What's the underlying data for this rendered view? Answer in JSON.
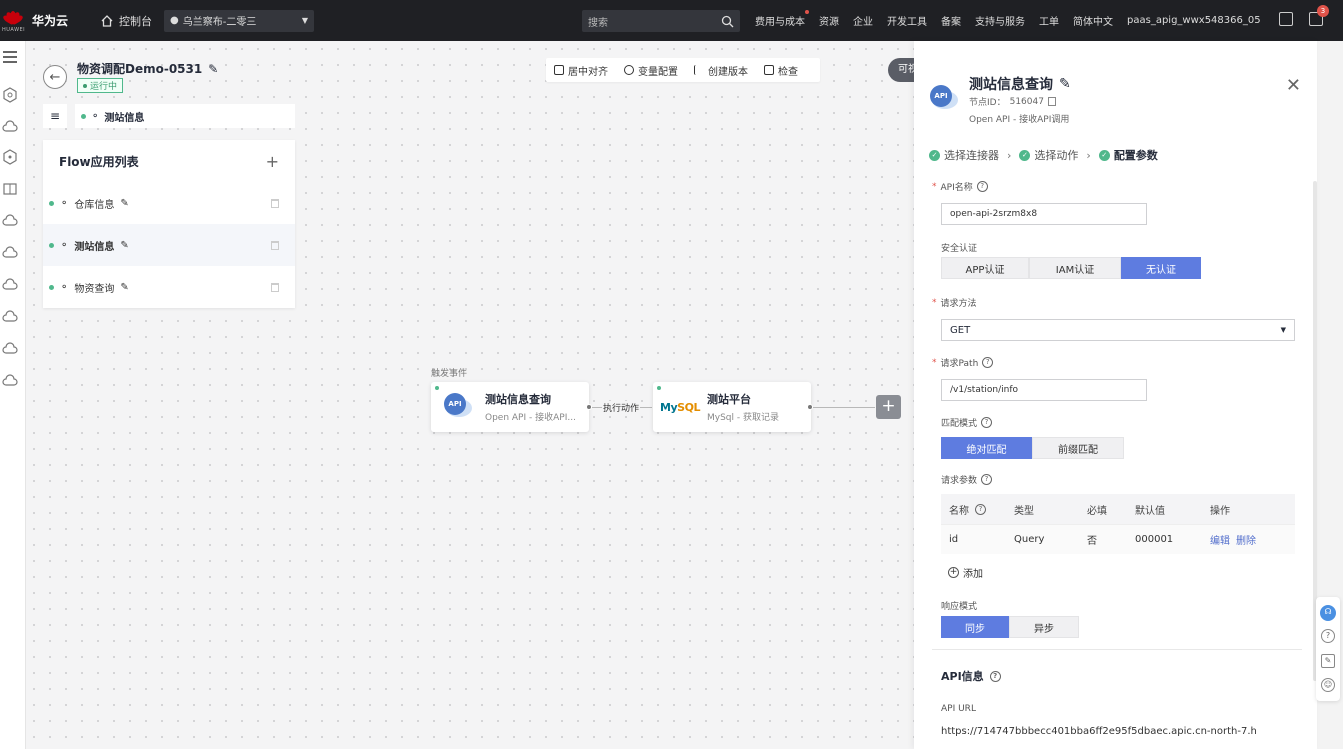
{
  "topbar": {
    "brand": "华为云",
    "brand_sub": "HUAWEI",
    "console": "控制台",
    "region": "乌兰察布-二零三",
    "search_placeholder": "搜索",
    "nav": [
      "费用与成本",
      "资源",
      "企业",
      "开发工具",
      "备案",
      "支持与服务",
      "工单",
      "简体中文",
      "paas_apig_wwx548366_05"
    ],
    "notification_count": "3"
  },
  "project": {
    "title": "物资调配Demo-0531",
    "status": "运行中"
  },
  "flow_tab": {
    "label": "测站信息"
  },
  "flow_list": {
    "title": "Flow应用列表",
    "items": [
      {
        "label": "仓库信息"
      },
      {
        "label": "测站信息"
      },
      {
        "label": "物资查询"
      }
    ]
  },
  "toolbar": {
    "items": [
      "居中对齐",
      "变量配置",
      "创建版本",
      "检查"
    ],
    "cut_pill": "可视"
  },
  "canvas": {
    "trigger_label": "触发事件",
    "node1": {
      "title": "测站信息查询",
      "subtitle": "Open API - 接收API...",
      "icon": "API"
    },
    "connector_label": "执行动作",
    "node2": {
      "title": "测站平台",
      "subtitle": "MySql - 获取记录",
      "icon_main": "My",
      "icon_accent": "SQL"
    }
  },
  "panel": {
    "icon": "API",
    "title": "测站信息查询",
    "node_id_label": "节点ID：",
    "node_id": "516047",
    "subtitle": "Open API - 接收API调用",
    "steps": [
      "选择连接器",
      "选择动作",
      "配置参数"
    ],
    "api_name_label": "API名称",
    "api_name_value": "open-api-2srzm8x8",
    "auth_label": "安全认证",
    "auth_options": [
      "APP认证",
      "IAM认证",
      "无认证"
    ],
    "auth_selected": 2,
    "method_label": "请求方法",
    "method_value": "GET",
    "path_label": "请求Path",
    "path_value": "/v1/station/info",
    "match_label": "匹配模式",
    "match_options": [
      "绝对匹配",
      "前缀匹配"
    ],
    "params_label": "请求参数",
    "params_headers": [
      "名称",
      "类型",
      "必填",
      "默认值",
      "操作"
    ],
    "params_rows": [
      {
        "name": "id",
        "type": "Query",
        "required": "否",
        "default": "000001",
        "edit": "编辑",
        "delete": "删除"
      }
    ],
    "add_label": "添加",
    "response_label": "响应模式",
    "response_options": [
      "同步",
      "异步"
    ],
    "api_info_title": "API信息",
    "api_url_label": "API URL",
    "api_url_value": "https://714747bbbecc401bba6ff2e95f5dbaec.apic.cn-north-7.h"
  },
  "colors": {
    "topbar_bg": "#1f2024",
    "accent_blue": "#5e7ce0",
    "status_green": "#50b88c",
    "brand_red": "#c7000b"
  }
}
